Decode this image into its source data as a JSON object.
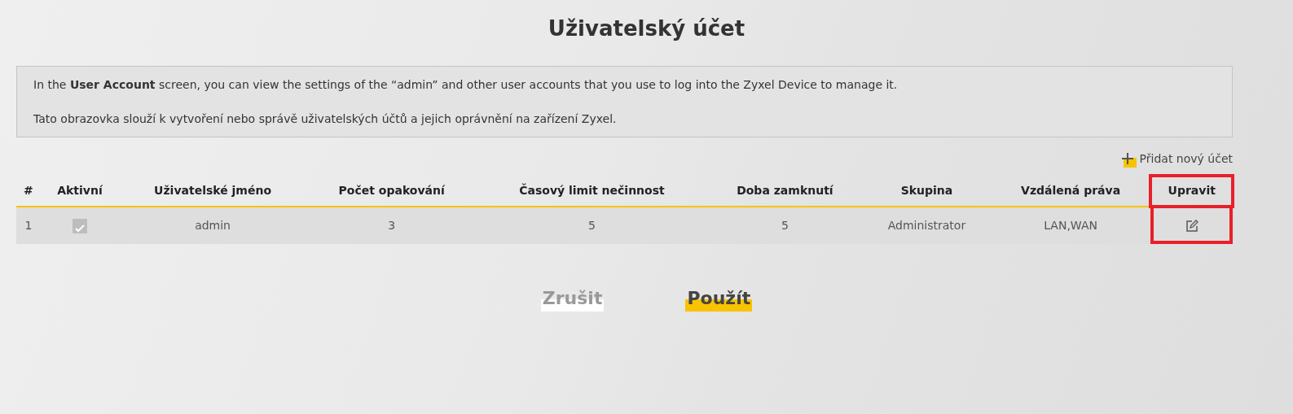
{
  "title": "Uživatelský účet",
  "info": [
    "In the **User Account** screen, you can view the settings of the “admin” and other user accounts that you use to log into the Zyxel Device to manage it.",
    "Tato obrazovka slouží k vytvoření nebo správě uživatelských účtů a jejich oprávnění na zařízení Zyxel."
  ],
  "add_link": "Přidat nový účet",
  "table": {
    "columns": [
      {
        "label": "#",
        "highlighted": false
      },
      {
        "label": "Aktivní",
        "highlighted": false
      },
      {
        "label": "Uživatelské jméno",
        "highlighted": false
      },
      {
        "label": "Počet opakování",
        "highlighted": false
      },
      {
        "label": "Časový limit nečinnost",
        "highlighted": false
      },
      {
        "label": "Doba zamknutí",
        "highlighted": false
      },
      {
        "label": "Skupina",
        "highlighted": false
      },
      {
        "label": "Vzdálená práva",
        "highlighted": false
      },
      {
        "label": "Upravit",
        "highlighted": true
      }
    ],
    "rows": [
      {
        "index": "1",
        "active": {
          "checked": true,
          "disabled": true
        },
        "username": "admin",
        "retries": "3",
        "idle_timeout": "5",
        "lock_time": "5",
        "group": "Administrator",
        "remote": "LAN,WAN"
      }
    ]
  },
  "buttons": [
    {
      "label": "Zrušit",
      "kind": "cancel"
    },
    {
      "label": "Použít",
      "kind": "apply"
    }
  ]
}
